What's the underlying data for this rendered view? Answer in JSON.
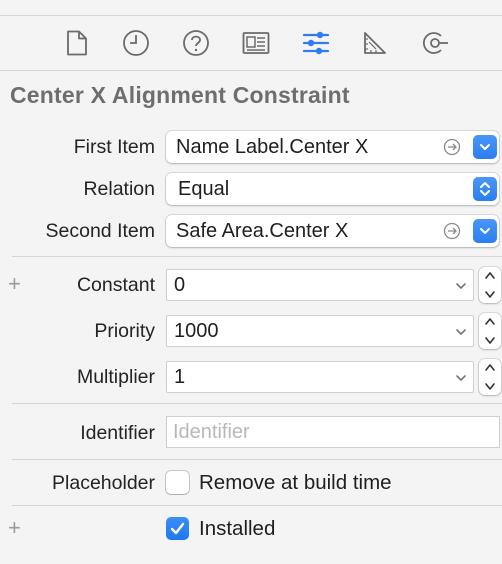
{
  "toolbar": {
    "icons": [
      "file-inspector-icon",
      "history-inspector-icon",
      "quick-help-icon",
      "identity-inspector-icon",
      "attributes-inspector-icon",
      "size-inspector-icon",
      "connections-inspector-icon"
    ],
    "active": "attributes-inspector-icon",
    "active_color": "#2f7bf5"
  },
  "section": {
    "title": "Center X Alignment Constraint"
  },
  "first_item": {
    "label": "First Item",
    "value": "Name Label.Center X"
  },
  "relation": {
    "label": "Relation",
    "value": "Equal"
  },
  "second_item": {
    "label": "Second Item",
    "value": "Safe Area.Center X"
  },
  "constant": {
    "label": "Constant",
    "value": "0",
    "plus": "+"
  },
  "priority": {
    "label": "Priority",
    "value": "1000"
  },
  "multiplier": {
    "label": "Multiplier",
    "value": "1"
  },
  "identifier": {
    "label": "Identifier",
    "placeholder": "Identifier",
    "value": ""
  },
  "placeholder": {
    "label": "Placeholder",
    "checkbox_label": "Remove at build time",
    "checked": false
  },
  "installed": {
    "checkbox_label": "Installed",
    "checked": true,
    "plus": "+"
  },
  "colors": {
    "accent": "#2f7bf5",
    "background": "#f4f4f4"
  }
}
